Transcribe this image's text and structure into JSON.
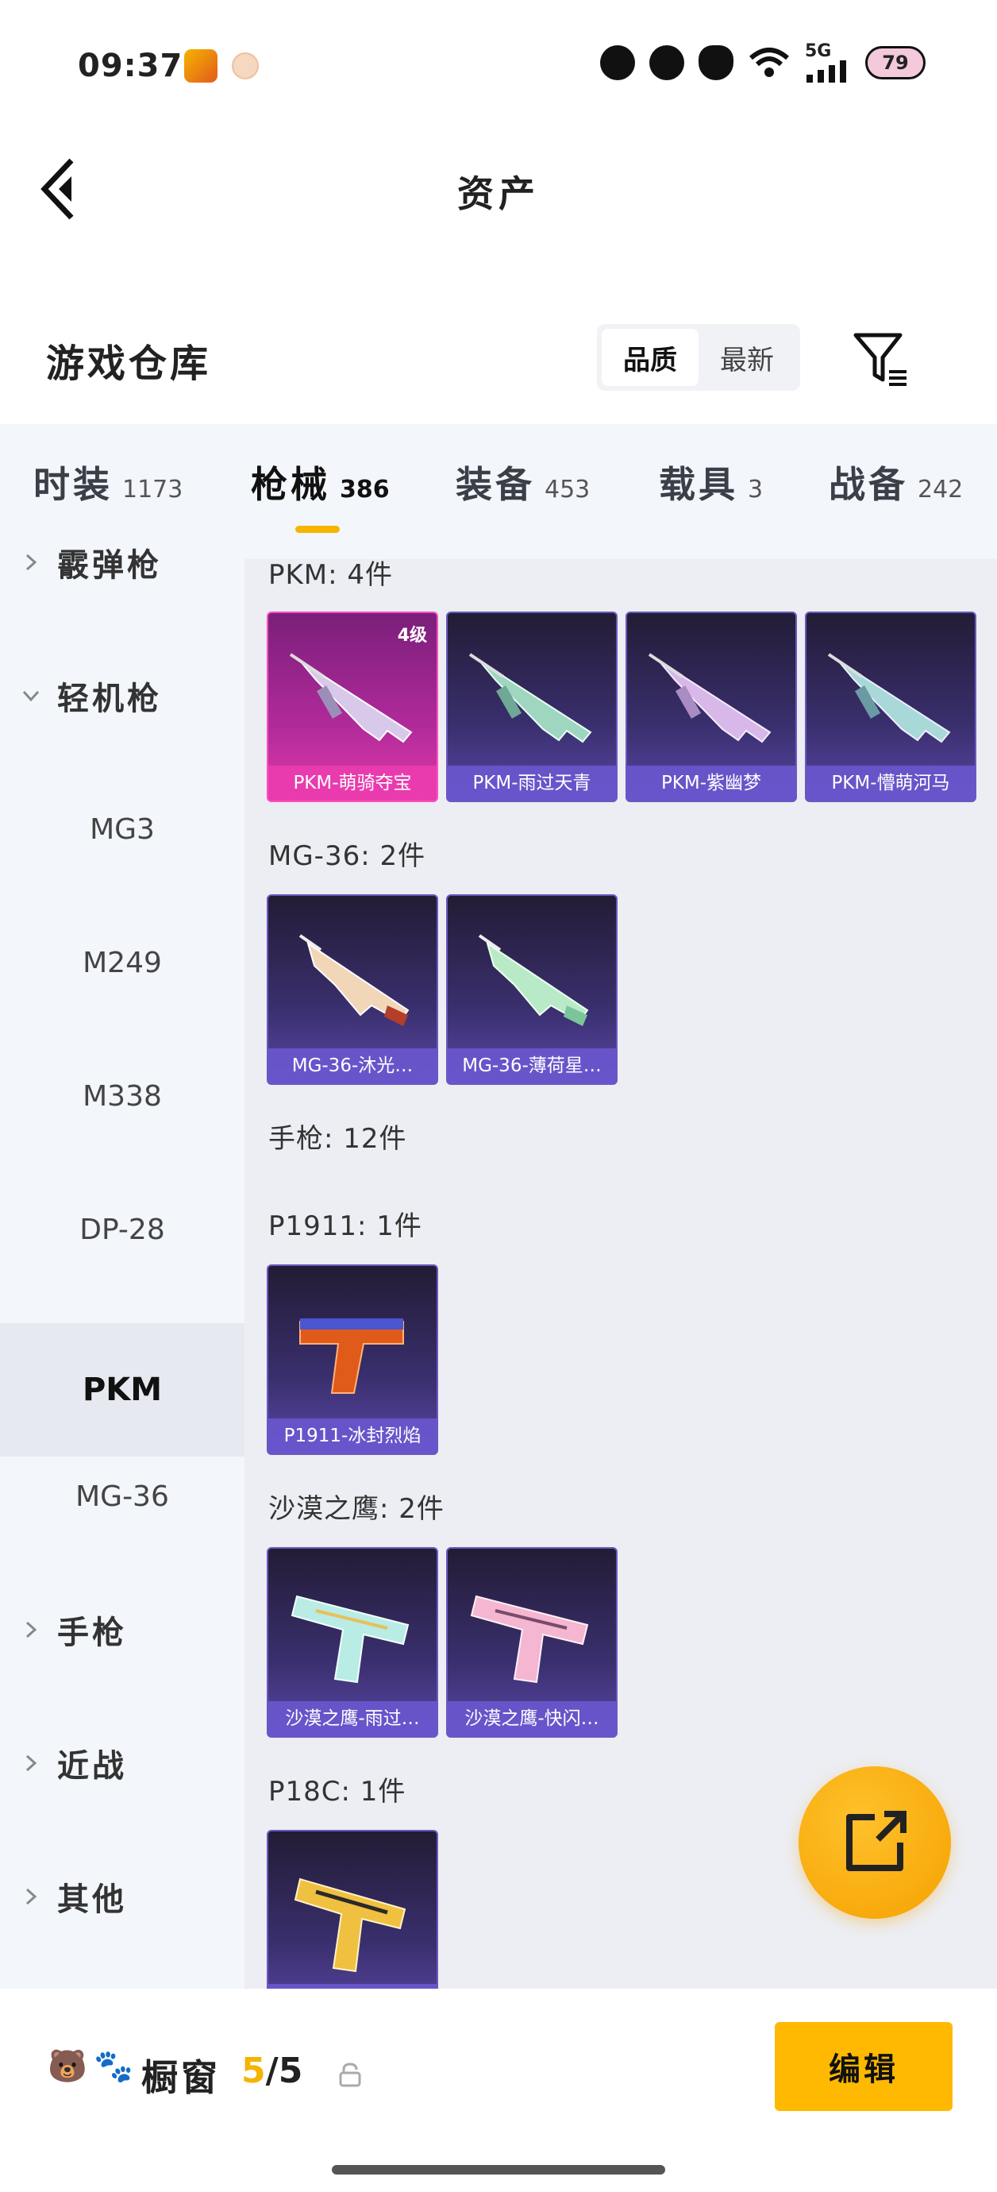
{
  "status": {
    "time": "09:37",
    "network": "5G",
    "battery": "79"
  },
  "header": {
    "title": "资产"
  },
  "warehouse": {
    "title": "游戏仓库",
    "sort_quality": "品质",
    "sort_latest": "最新"
  },
  "tabs": [
    {
      "label": "时装",
      "count": "1173"
    },
    {
      "label": "枪械",
      "count": "386",
      "active": true
    },
    {
      "label": "装备",
      "count": "453"
    },
    {
      "label": "载具",
      "count": "3"
    },
    {
      "label": "战备",
      "count": "242"
    }
  ],
  "sidebar": [
    {
      "label": "霰弹枪",
      "type": "group",
      "expanded": false
    },
    {
      "label": "轻机枪",
      "type": "group",
      "expanded": true
    },
    {
      "label": "MG3",
      "type": "sub"
    },
    {
      "label": "M249",
      "type": "sub"
    },
    {
      "label": "M338",
      "type": "sub"
    },
    {
      "label": "DP-28",
      "type": "sub"
    },
    {
      "label": "PKM",
      "type": "sub",
      "selected": true
    },
    {
      "label": "MG-36",
      "type": "sub"
    },
    {
      "label": "手枪",
      "type": "group",
      "expanded": false
    },
    {
      "label": "近战",
      "type": "group",
      "expanded": false
    },
    {
      "label": "其他",
      "type": "group",
      "expanded": false
    }
  ],
  "sections": {
    "pkm": {
      "label": "PKM: 4件",
      "items": [
        {
          "name": "PKM-萌骑夺宝",
          "level": "4级",
          "rarity": "legend"
        },
        {
          "name": "PKM-雨过天青",
          "rarity": "epic"
        },
        {
          "name": "PKM-紫幽梦",
          "rarity": "epic"
        },
        {
          "name": "PKM-懵萌河马",
          "rarity": "epic"
        }
      ]
    },
    "mg36": {
      "label": "MG-36: 2件",
      "items": [
        {
          "name": "MG-36-沐光…",
          "rarity": "epic"
        },
        {
          "name": "MG-36-薄荷星…",
          "rarity": "epic"
        }
      ]
    },
    "pistol": {
      "label": "手枪: 12件"
    },
    "p1911": {
      "label": "P1911: 1件",
      "items": [
        {
          "name": "P1911-冰封烈焰",
          "rarity": "epic"
        }
      ]
    },
    "deagle": {
      "label": "沙漠之鹰: 2件",
      "items": [
        {
          "name": "沙漠之鹰-雨过…",
          "rarity": "epic"
        },
        {
          "name": "沙漠之鹰-快闪…",
          "rarity": "epic"
        }
      ]
    },
    "p18c": {
      "label": "P18C: 1件",
      "items": [
        {
          "name": "",
          "rarity": "epic"
        }
      ]
    }
  },
  "bottom": {
    "label": "橱窗",
    "count_current": "5",
    "count_sep_total": "/5",
    "edit": "编辑"
  },
  "colors": {
    "accent": "#f7b500",
    "legend": "#e03aa8",
    "epic": "#6a58c0"
  },
  "icons": [
    "back-arrow-icon",
    "filter-icon",
    "chevron-right-icon",
    "chevron-down-icon",
    "share-icon",
    "lock-icon"
  ]
}
